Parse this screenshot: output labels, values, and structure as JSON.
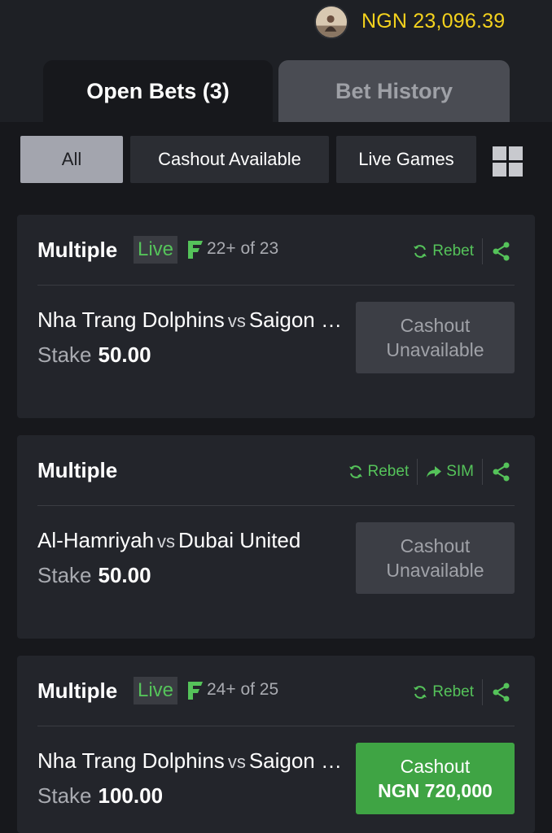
{
  "header": {
    "balance": "NGN 23,096.39"
  },
  "tabs": {
    "open_bets": "Open Bets (3)",
    "bet_history": "Bet History"
  },
  "filters": {
    "all": "All",
    "cashout_available": "Cashout Available",
    "live_games": "Live Games"
  },
  "colors": {
    "accent_green": "#55c35a",
    "balance_yellow": "#f4d21d",
    "cashout_green": "#3fa444"
  },
  "bets": [
    {
      "title": "Multiple",
      "live": "Live",
      "legs": "22+ of 23",
      "rebet": "Rebet",
      "match_home": "Nha Trang Dolphins",
      "vs": "vs",
      "match_away": "Saigon Heat",
      "stake_label": "Stake",
      "stake_value": "50.00",
      "cashout_line1": "Cashout",
      "cashout_line2": "Unavailable"
    },
    {
      "title": "Multiple",
      "rebet": "Rebet",
      "sim": "SIM",
      "match_home": "Al-Hamriyah",
      "vs": "vs",
      "match_away": "Dubai United",
      "stake_label": "Stake",
      "stake_value": "50.00",
      "cashout_line1": "Cashout",
      "cashout_line2": "Unavailable"
    },
    {
      "title": "Multiple",
      "live": "Live",
      "legs": "24+ of 25",
      "rebet": "Rebet",
      "match_home": "Nha Trang Dolphins",
      "vs": "vs",
      "match_away": "Saigon Heat",
      "stake_label": "Stake",
      "stake_value": "100.00",
      "cashout_line1": "Cashout",
      "cashout_line2": "NGN 720,000"
    }
  ]
}
